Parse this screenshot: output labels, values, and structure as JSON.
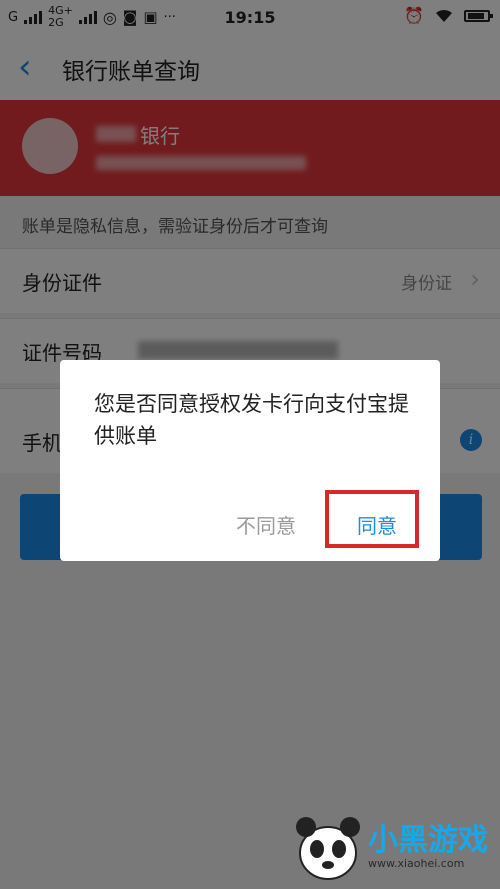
{
  "status_bar": {
    "carrier_g": "G",
    "net_top": "4G+",
    "net_bottom": "2G",
    "time": "19:15",
    "more": "···"
  },
  "nav": {
    "back_icon": "chevron-left-icon",
    "title": "银行账单查询"
  },
  "bank": {
    "name_suffix": "银行"
  },
  "form": {
    "privacy_note": "账单是隐私信息，需验证身份后才可查询",
    "id_type_label": "身份证件",
    "id_type_value": "身份证",
    "id_number_label": "证件号码",
    "phone_label": "手机"
  },
  "dialog": {
    "message": "您是否同意授权发卡行向支付宝提供账单",
    "disagree_label": "不同意",
    "agree_label": "同意"
  },
  "colors": {
    "accent": "#1a8be8",
    "bank_banner": "#e2373c",
    "highlight": "#d8262b"
  },
  "watermark": {
    "text": "小黑游戏",
    "url": "www.xiaohei.com"
  }
}
